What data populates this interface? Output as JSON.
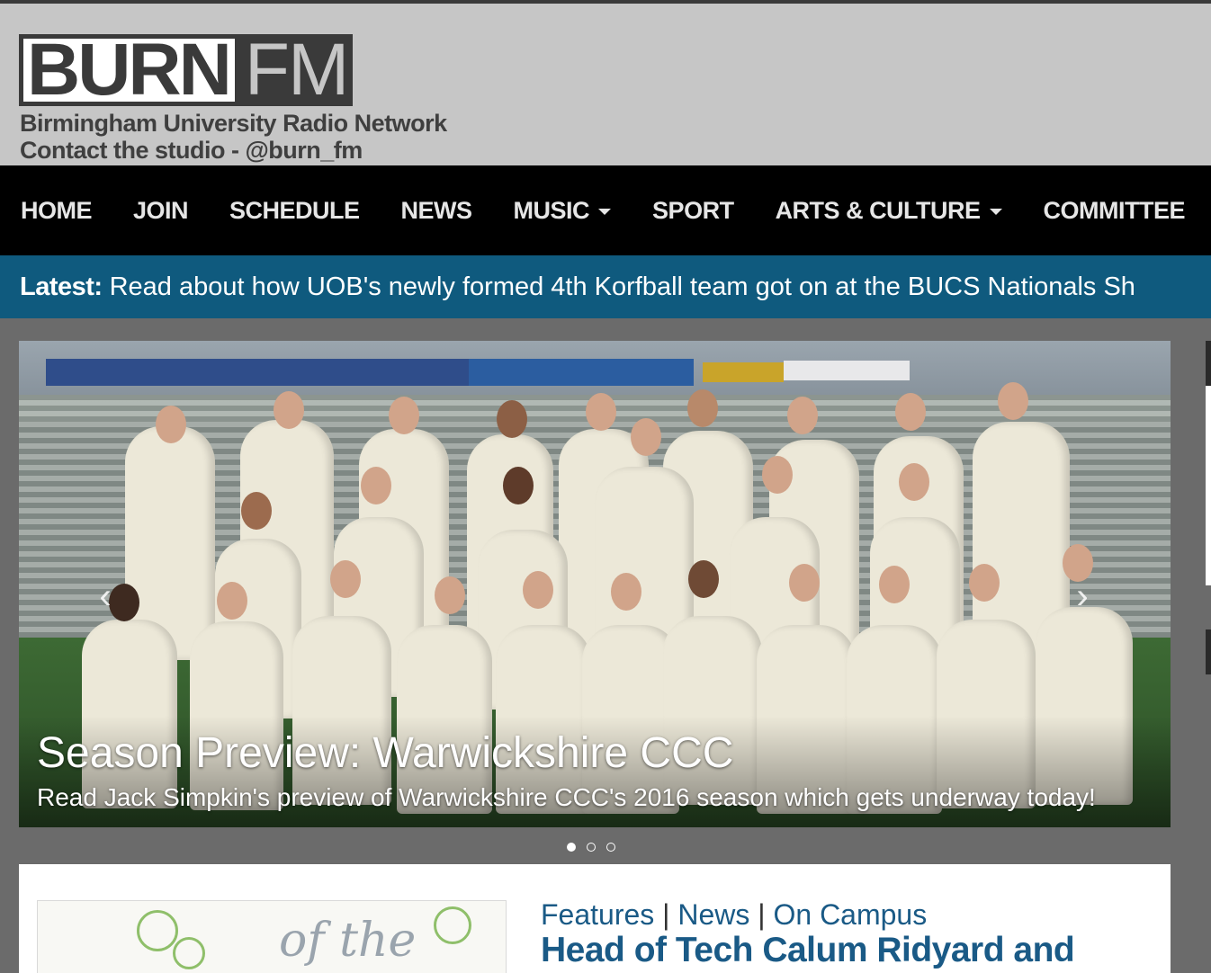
{
  "brand": {
    "logo_left": "BURN",
    "logo_right": "FM",
    "tagline_line1": "Birmingham University Radio Network",
    "tagline_line2": "Contact the studio - @burn_fm"
  },
  "nav": {
    "items": [
      {
        "label": "HOME",
        "dropdown": false
      },
      {
        "label": "JOIN",
        "dropdown": false
      },
      {
        "label": "SCHEDULE",
        "dropdown": false
      },
      {
        "label": "NEWS",
        "dropdown": false
      },
      {
        "label": "MUSIC",
        "dropdown": true
      },
      {
        "label": "SPORT",
        "dropdown": false
      },
      {
        "label": "ARTS & CULTURE",
        "dropdown": true
      },
      {
        "label": "COMMITTEE",
        "dropdown": false
      }
    ]
  },
  "ticker": {
    "label": "Latest:",
    "text": "Read about how UOB's newly formed 4th Korfball team got on at the BUCS Nationals Sh"
  },
  "carousel": {
    "title": "Season Preview: Warwickshire CCC",
    "text": "Read Jack Simpkin's preview of Warwickshire CCC's 2016 season which gets underway today!",
    "prev_icon": "chevron-left-icon",
    "next_icon": "chevron-right-icon",
    "slide_count": 3,
    "active_slide": 1
  },
  "article": {
    "categories": [
      "Features",
      "News",
      "On Campus"
    ],
    "category_separator": "|",
    "headline": "Head of Tech Calum Ridyard and",
    "thumb_text": "of the"
  },
  "colors": {
    "header_bg": "#c6c6c6",
    "nav_bg": "#000000",
    "ticker_bg": "#0f5a7e",
    "link_blue": "#1a5a86",
    "page_bg": "#6b6b6b"
  }
}
